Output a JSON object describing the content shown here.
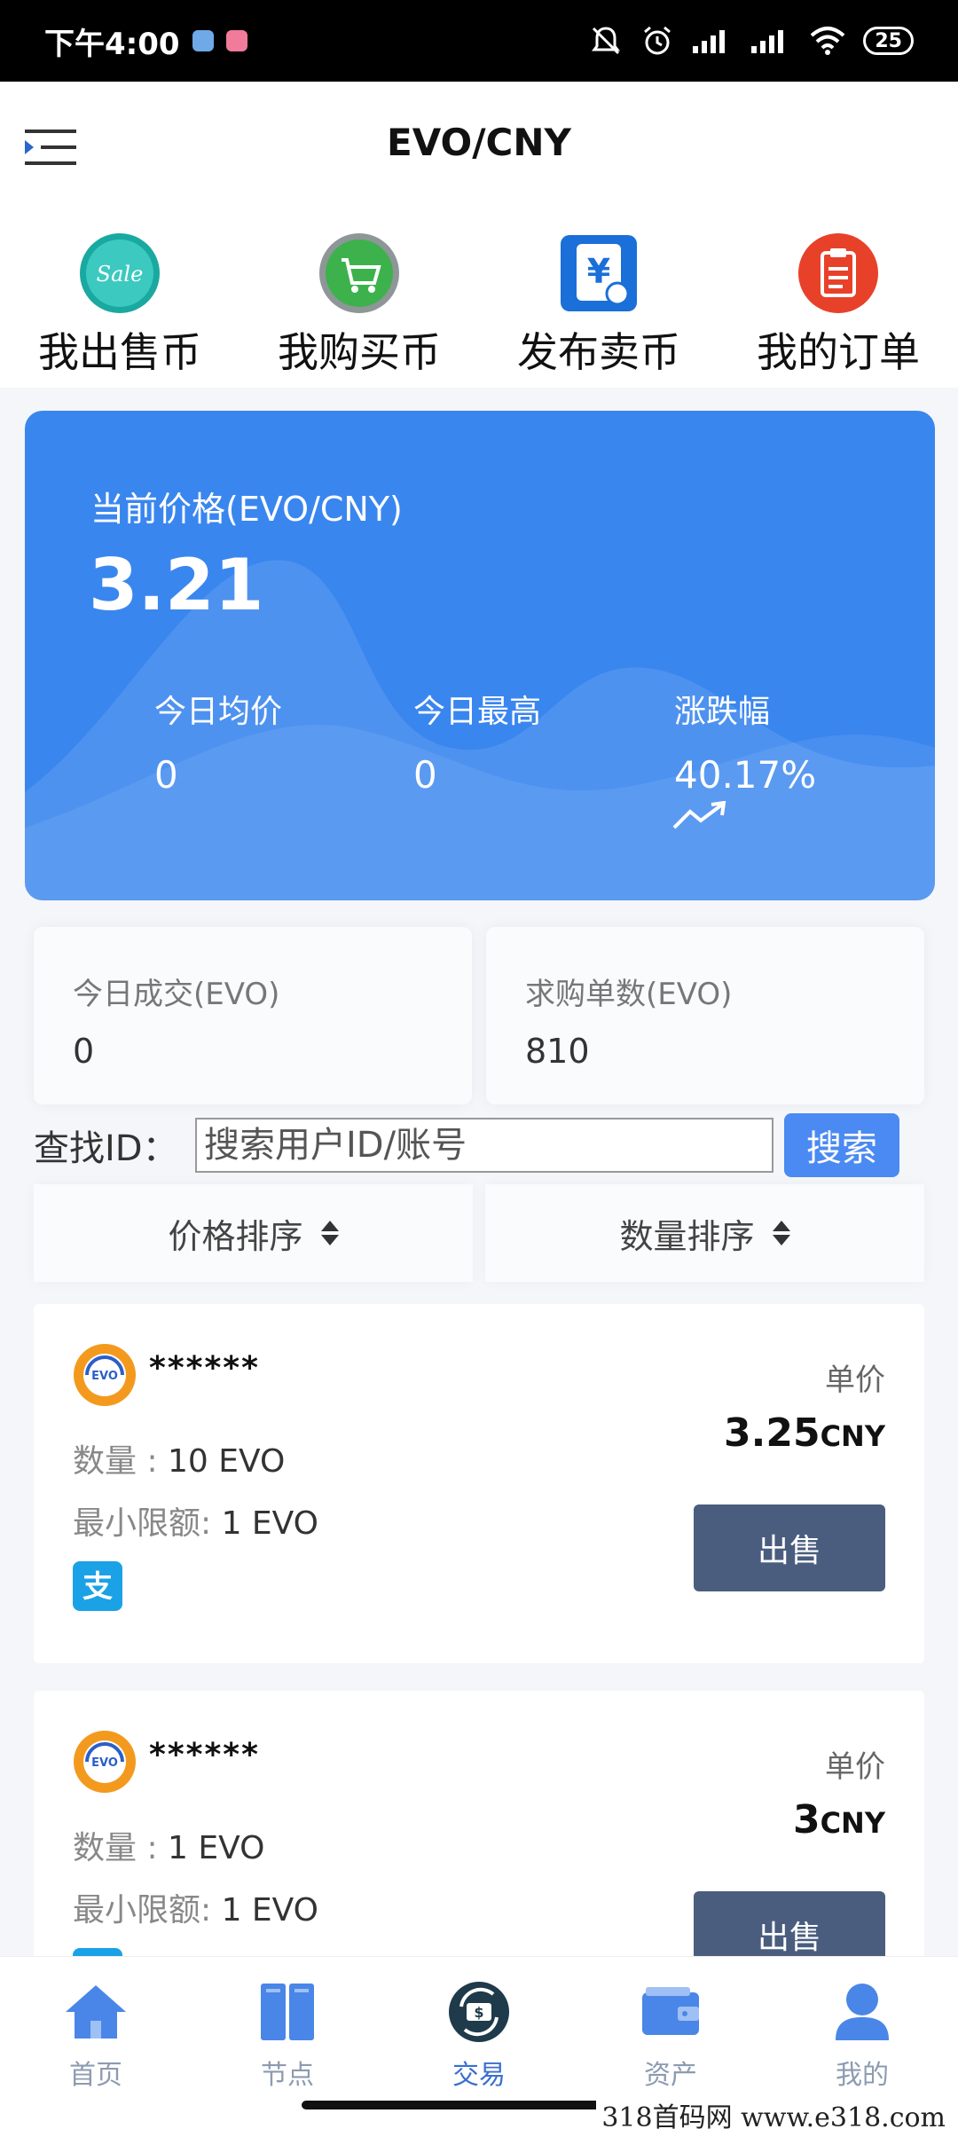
{
  "status_bar": {
    "time": "下午4:00",
    "battery": "25"
  },
  "header": {
    "title": "EVO/CNY"
  },
  "quick_actions": [
    {
      "label": "我出售币",
      "icon": "sale-badge-icon"
    },
    {
      "label": "我购买币",
      "icon": "shopping-cart-icon"
    },
    {
      "label": "发布卖币",
      "icon": "yen-document-icon"
    },
    {
      "label": "我的订单",
      "icon": "clipboard-icon"
    }
  ],
  "price_card": {
    "label": "当前价格(EVO/CNY)",
    "price": "3.21",
    "stats": [
      {
        "label": "今日均价",
        "value": "0"
      },
      {
        "label": "今日最高",
        "value": "0"
      },
      {
        "label": "涨跌幅",
        "value": "40.17%"
      }
    ],
    "trend_icon": "trending-up-icon",
    "color": "#3a86ef"
  },
  "summary": [
    {
      "label": "今日成交(EVO)",
      "value": "0"
    },
    {
      "label": "求购单数(EVO)",
      "value": "810"
    }
  ],
  "search": {
    "label": "查找ID：",
    "placeholder": "搜索用户ID/账号",
    "button": "搜索"
  },
  "sort": [
    {
      "label": "价格排序"
    },
    {
      "label": "数量排序"
    }
  ],
  "listings": [
    {
      "user": "******",
      "qty_label": "数量 : ",
      "qty": "10 EVO",
      "limit_label": "最小限额: ",
      "limit": "1 EVO",
      "unit_label": "单价",
      "price": "3.25",
      "currency": "CNY",
      "action": "出售",
      "pay_icon": "alipay-icon"
    },
    {
      "user": "******",
      "qty_label": "数量 : ",
      "qty": "1 EVO",
      "limit_label": "最小限额: ",
      "limit": "1 EVO",
      "unit_label": "单价",
      "price": "3",
      "currency": "CNY",
      "action": "出售",
      "pay_icon": "alipay-icon"
    }
  ],
  "bottom_nav": [
    {
      "label": "首页",
      "icon": "home-icon"
    },
    {
      "label": "节点",
      "icon": "node-icon"
    },
    {
      "label": "交易",
      "icon": "exchange-icon",
      "active": true
    },
    {
      "label": "资产",
      "icon": "wallet-icon"
    },
    {
      "label": "我的",
      "icon": "user-icon"
    }
  ],
  "watermark": "318首码网  www.e318.com"
}
